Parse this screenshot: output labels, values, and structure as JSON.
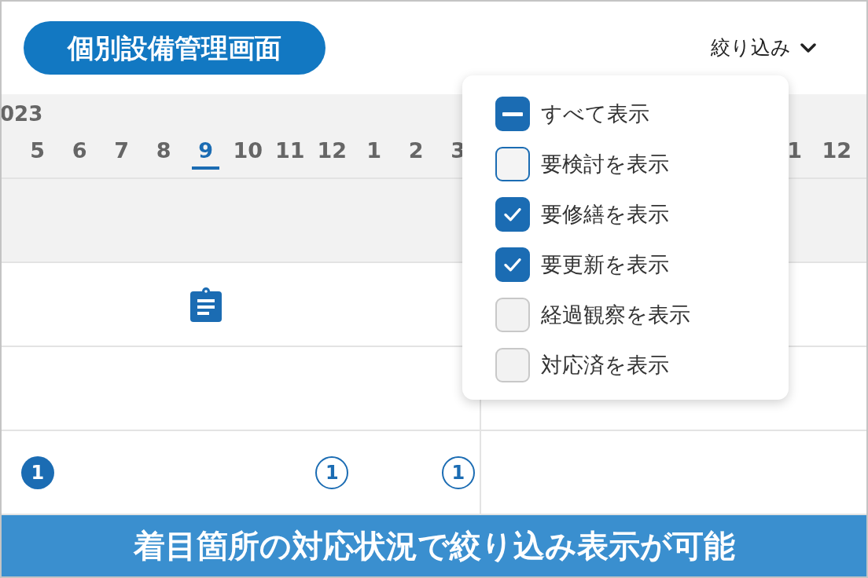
{
  "title": "個別設備管理画面",
  "filter": {
    "label": "絞り込み"
  },
  "timeline": {
    "year": "023",
    "months": [
      {
        "label": "5",
        "selected": false
      },
      {
        "label": "6",
        "selected": false
      },
      {
        "label": "7",
        "selected": false
      },
      {
        "label": "8",
        "selected": false
      },
      {
        "label": "9",
        "selected": true
      },
      {
        "label": "10",
        "selected": false
      },
      {
        "label": "11",
        "selected": false
      },
      {
        "label": "12",
        "selected": false
      },
      {
        "label": "1",
        "selected": false
      },
      {
        "label": "2",
        "selected": false
      },
      {
        "label": "3",
        "selected": false
      }
    ],
    "months_after_menu": [
      {
        "label": "1",
        "selected": false
      },
      {
        "label": "12",
        "selected": false
      }
    ]
  },
  "rows": [
    {
      "shaded": true,
      "cells": []
    },
    {
      "shaded": false,
      "cells": [
        null,
        null,
        null,
        null,
        {
          "kind": "clipboard"
        }
      ]
    },
    {
      "shaded": false,
      "cells": []
    },
    {
      "shaded": false,
      "cells": [
        {
          "kind": "count",
          "text": "1",
          "filled": true
        },
        null,
        null,
        null,
        null,
        null,
        null,
        {
          "kind": "count",
          "text": "1",
          "filled": false
        },
        null,
        null,
        {
          "kind": "count",
          "text": "1",
          "filled": false
        }
      ]
    }
  ],
  "filter_menu": [
    {
      "label": "すべて表示",
      "checked": true,
      "indeterminate": true,
      "disabled": false
    },
    {
      "label": "要検討を表示",
      "checked": false,
      "indeterminate": false,
      "disabled": false
    },
    {
      "label": "要修繕を表示",
      "checked": true,
      "indeterminate": false,
      "disabled": false
    },
    {
      "label": "要更新を表示",
      "checked": true,
      "indeterminate": false,
      "disabled": false
    },
    {
      "label": "経過観察を表示",
      "checked": false,
      "indeterminate": false,
      "disabled": true
    },
    {
      "label": "対応済を表示",
      "checked": false,
      "indeterminate": false,
      "disabled": true
    }
  ],
  "caption": "着目箇所の対応状況で絞り込み表示が可能"
}
